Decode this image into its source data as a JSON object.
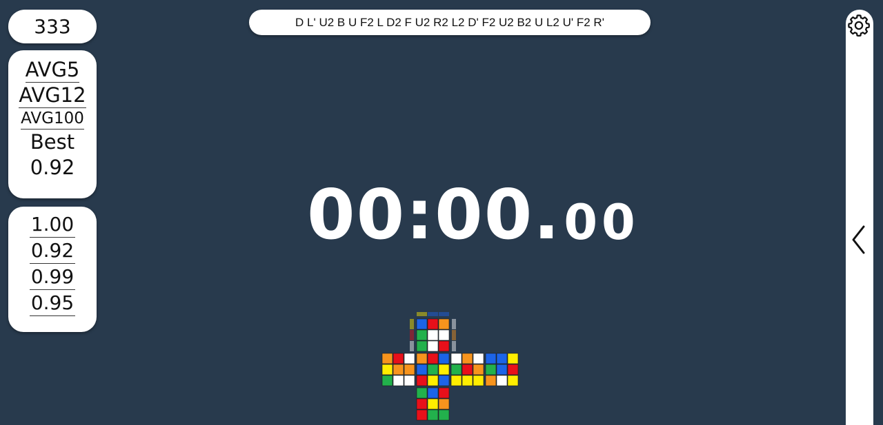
{
  "solve_count": "333",
  "stats": {
    "avg5_label": "AVG5",
    "avg12_label": "AVG12",
    "avg100_label": "AVG100",
    "best_label": "Best",
    "best_value": "0.92"
  },
  "recent_times": [
    "1.00",
    "0.92",
    "0.99",
    "0.95"
  ],
  "scramble": "D L' U2 B U F2 L D2 F U2 R2 L2 D' F2 U2 B2 U L2 U' F2 R'",
  "timer": {
    "main": "00:00.",
    "centiseconds": "00"
  },
  "icons": {
    "settings": "gear-icon",
    "collapse": "chevron-left-icon"
  },
  "colors": {
    "background": "#283a4d",
    "W": "#ffffff",
    "Y": "#ffee00",
    "R": "#e8101a",
    "O": "#f7941d",
    "B": "#1c64e8",
    "G": "#22b14c"
  },
  "cube_net": {
    "U": [
      "BRO",
      "GWW",
      "GWR"
    ],
    "L": [
      "ORW",
      "YOO",
      "GWW"
    ],
    "F": [
      "ORB",
      "BGY",
      "RYB"
    ],
    "R": [
      "WOW",
      "GRO",
      "YYY"
    ],
    "B": [
      "BBY",
      "GBR",
      "OWY"
    ],
    "D": [
      "GBR",
      "RYO",
      "RGG"
    ]
  }
}
